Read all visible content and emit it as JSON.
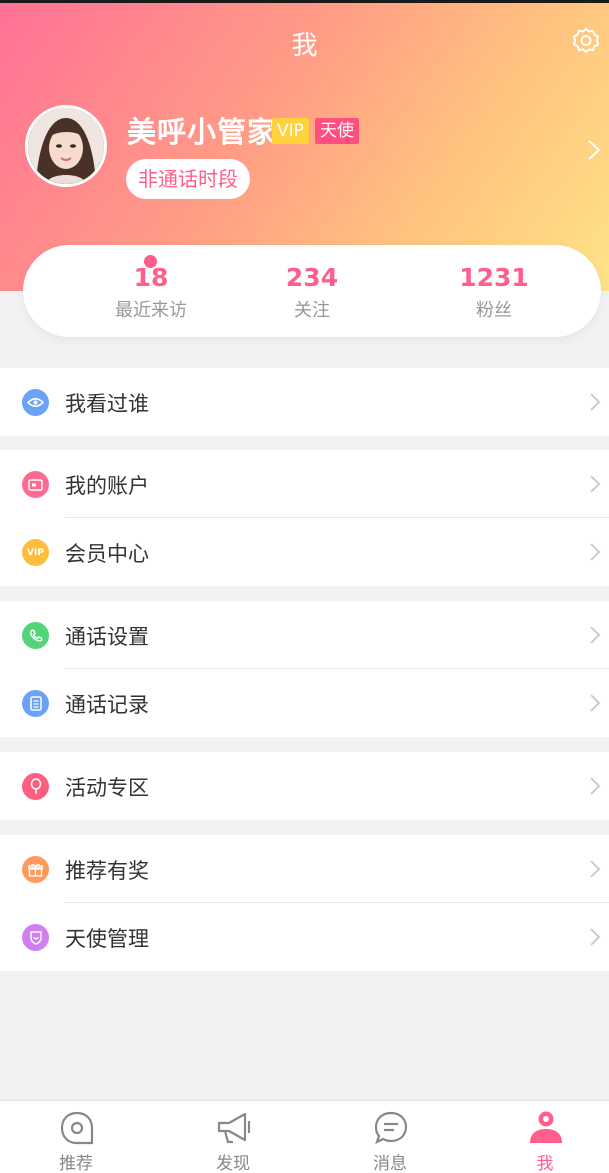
{
  "header": {
    "title": "我",
    "settings_icon": "gear-icon"
  },
  "profile": {
    "name": "美呼小管家",
    "vip_badge": "VIP",
    "angel_badge": "天使",
    "status": "非通话时段"
  },
  "stats": [
    {
      "value": "18",
      "label": "最近来访"
    },
    {
      "value": "234",
      "label": "关注"
    },
    {
      "value": "1231",
      "label": "粉丝"
    }
  ],
  "menu": [
    {
      "label": "我看过谁",
      "icon": "eye-icon",
      "color": "#6aa3f5"
    },
    {
      "label": "我的账户",
      "icon": "wallet-icon",
      "color": "#ff6b8e"
    },
    {
      "label": "会员中心",
      "icon": "vip-icon",
      "color": "#ffbd3c"
    },
    {
      "label": "通话设置",
      "icon": "phone-icon",
      "color": "#53d37a"
    },
    {
      "label": "通话记录",
      "icon": "record-icon",
      "color": "#6aa3f5"
    },
    {
      "label": "活动专区",
      "icon": "balloon-icon",
      "color": "#ff5f7e"
    },
    {
      "label": "推荐有奖",
      "icon": "gift-icon",
      "color": "#ff9a5c"
    },
    {
      "label": "天使管理",
      "icon": "shield-icon",
      "color": "#cf7ff0"
    }
  ],
  "vip_icon_text": "VIP",
  "tabs": [
    {
      "label": "推荐",
      "icon": "recommend-icon",
      "active": false
    },
    {
      "label": "发现",
      "icon": "megaphone-icon",
      "active": false
    },
    {
      "label": "消息",
      "icon": "message-icon",
      "active": false
    },
    {
      "label": "我",
      "icon": "user-icon",
      "active": true
    }
  ],
  "colors": {
    "accent": "#ff5f8a",
    "header_gradient": [
      "#ff7196",
      "#ffc37f",
      "#ffe388"
    ],
    "background": "#f2f2f2"
  }
}
